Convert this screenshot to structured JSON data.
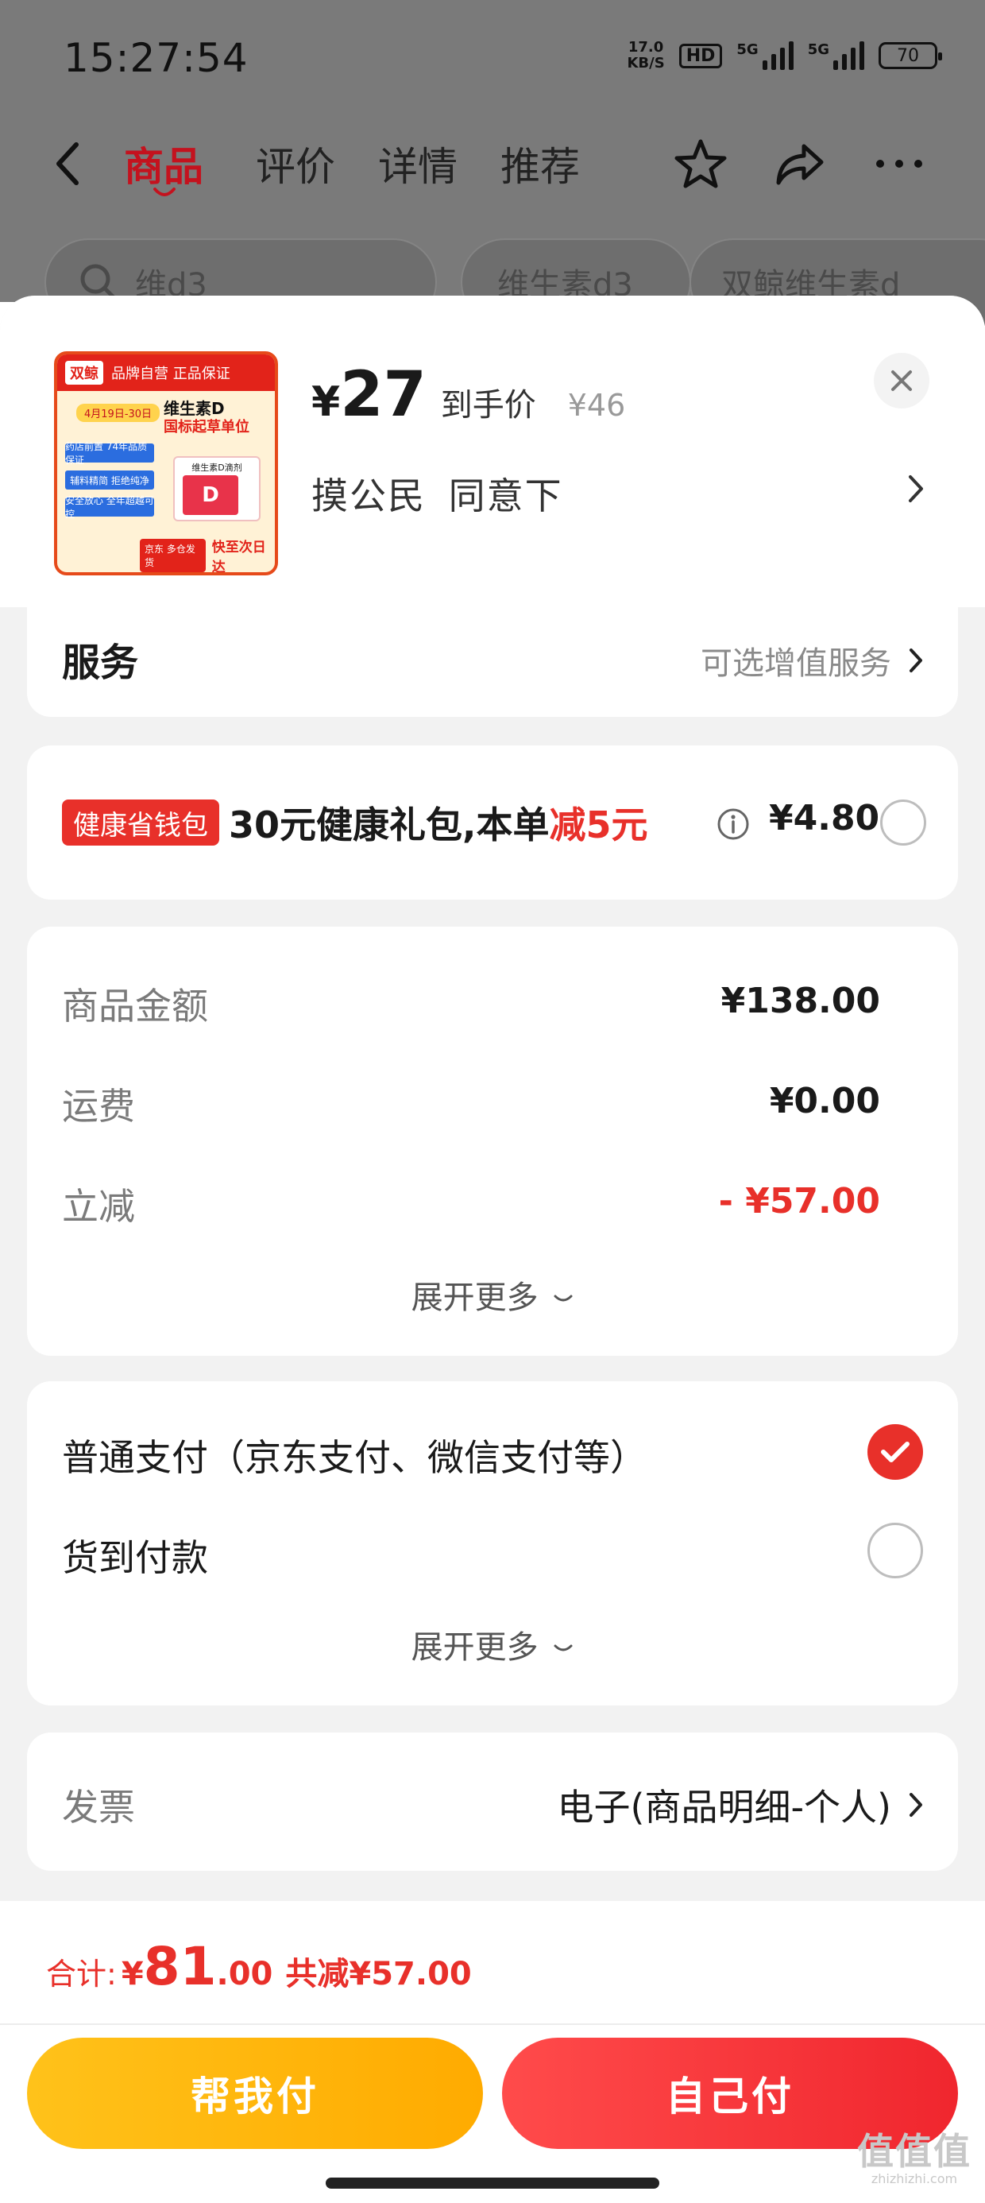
{
  "status_bar": {
    "time": "15:27:54",
    "net_speed_value": "17.0",
    "net_speed_unit": "KB/S",
    "hd": "HD",
    "sim1": "5G",
    "sim2": "5G",
    "battery": "70"
  },
  "nav": {
    "tabs": [
      "商品",
      "评价",
      "详情",
      "推荐"
    ],
    "active_tab": "商品",
    "icons": [
      "back-icon",
      "star-icon",
      "share-icon",
      "more-icon"
    ]
  },
  "search_chips": [
    "维d3",
    "维生素d3",
    "双鲸维生素d"
  ],
  "product": {
    "image_text": {
      "brand": "双鲸",
      "top": "品牌自营 正品保证",
      "date": "4月19日-30日",
      "title": "维生素D",
      "subtitle": "国标起草单位",
      "tags": [
        "药店前置 74年品质保证",
        "辅料精简 拒绝纯净",
        "安全放心 全年超越可控"
      ],
      "box_label": "维生素D滴剂",
      "box_mark": "D",
      "jd_badge": "京东 多仓发货",
      "fast": "快至次日达"
    },
    "price_symbol": "¥",
    "price": "27",
    "price_label": "到手价",
    "original_price": "¥46",
    "spec": "摸公民 同意下"
  },
  "service": {
    "title": "服务",
    "right_text": "可选增值服务"
  },
  "health": {
    "badge": "健康省钱包",
    "text_prefix": "30元健康礼包,本单",
    "text_highlight": "减5元",
    "price": "¥4.80",
    "selected": false
  },
  "amounts": {
    "rows": [
      {
        "label": "商品金额",
        "value": "¥138.00",
        "highlight": false
      },
      {
        "label": "运费",
        "value": "¥0.00",
        "highlight": false
      },
      {
        "label": "立减",
        "value": "- ¥57.00",
        "highlight": true
      }
    ],
    "expand": "展开更多"
  },
  "payment": {
    "options": [
      {
        "label": "普通支付（京东支付、微信支付等）",
        "selected": true
      },
      {
        "label": "货到付款",
        "selected": false
      }
    ],
    "expand": "展开更多"
  },
  "invoice": {
    "label": "发票",
    "value": "电子(商品明细-个人)"
  },
  "footer": {
    "total_label": "合计:",
    "total_symbol": "¥",
    "total_int": "81",
    "total_dec": ".00",
    "discount": "共减¥57.00",
    "help_pay": "帮我付",
    "self_pay": "自己付"
  },
  "watermark": {
    "glyphs": "值值值",
    "domain": "zhizhizhi.com"
  },
  "colors": {
    "accent_red": "#e8302a",
    "brand_red": "#c4121e",
    "help_pay_yellow": "#ffb300",
    "overlay_gray": "#7a7a7a"
  }
}
